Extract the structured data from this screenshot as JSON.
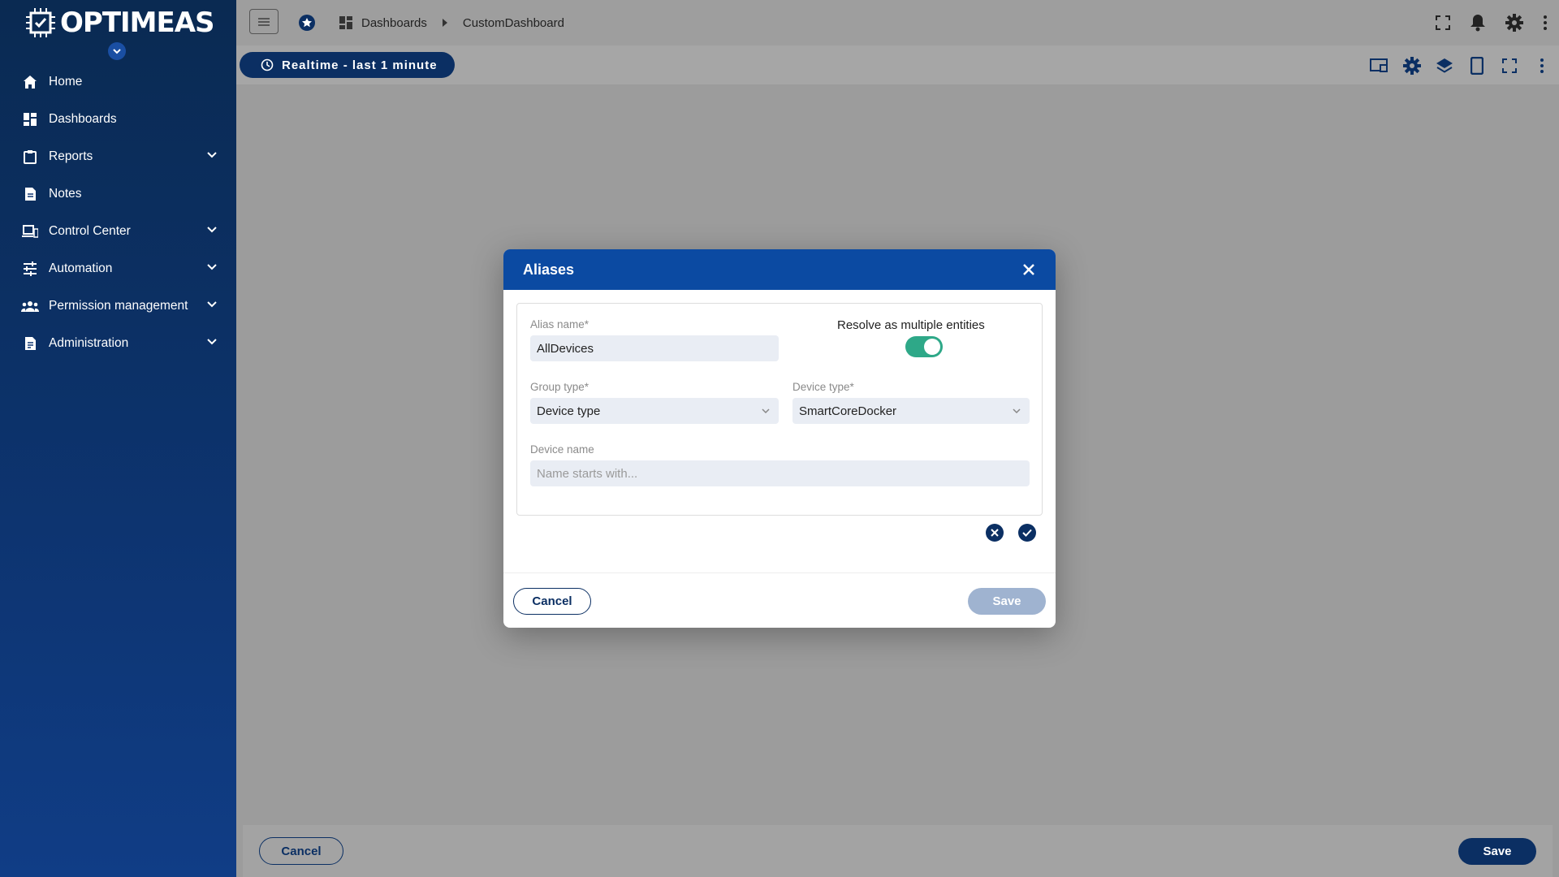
{
  "app": {
    "brand": "OPTIMEAS"
  },
  "sidebar": {
    "items": [
      {
        "label": "Home",
        "icon": "home-icon",
        "expandable": false
      },
      {
        "label": "Dashboards",
        "icon": "dashboard-icon",
        "expandable": false
      },
      {
        "label": "Reports",
        "icon": "clipboard-icon",
        "expandable": true
      },
      {
        "label": "Notes",
        "icon": "note-icon",
        "expandable": false
      },
      {
        "label": "Control Center",
        "icon": "devices-icon",
        "expandable": true
      },
      {
        "label": "Automation",
        "icon": "sliders-icon",
        "expandable": true
      },
      {
        "label": "Permission management",
        "icon": "people-icon",
        "expandable": true
      },
      {
        "label": "Administration",
        "icon": "document-icon",
        "expandable": true
      }
    ]
  },
  "header": {
    "breadcrumb": [
      "Dashboards",
      "CustomDashboard"
    ]
  },
  "toolbar": {
    "timewindow_label": "Realtime - last 1 minute"
  },
  "bottom_bar": {
    "cancel_label": "Cancel",
    "save_label": "Save"
  },
  "dialog": {
    "title": "Aliases",
    "alias_name": {
      "label": "Alias name*",
      "value": "AllDevices"
    },
    "resolve_multiple": {
      "label": "Resolve as multiple entities",
      "checked": true
    },
    "group_type": {
      "label": "Group type*",
      "value": "Device type"
    },
    "device_type": {
      "label": "Device type*",
      "value": "SmartCoreDocker"
    },
    "device_name": {
      "label": "Device name",
      "placeholder": "Name starts with..."
    },
    "cancel_label": "Cancel",
    "save_label": "Save"
  },
  "colors": {
    "primary": "#0b2f63",
    "dialog_header": "#0b4aa2",
    "toggle_on": "#2ea888",
    "save_disabled": "#9fb3d0"
  }
}
